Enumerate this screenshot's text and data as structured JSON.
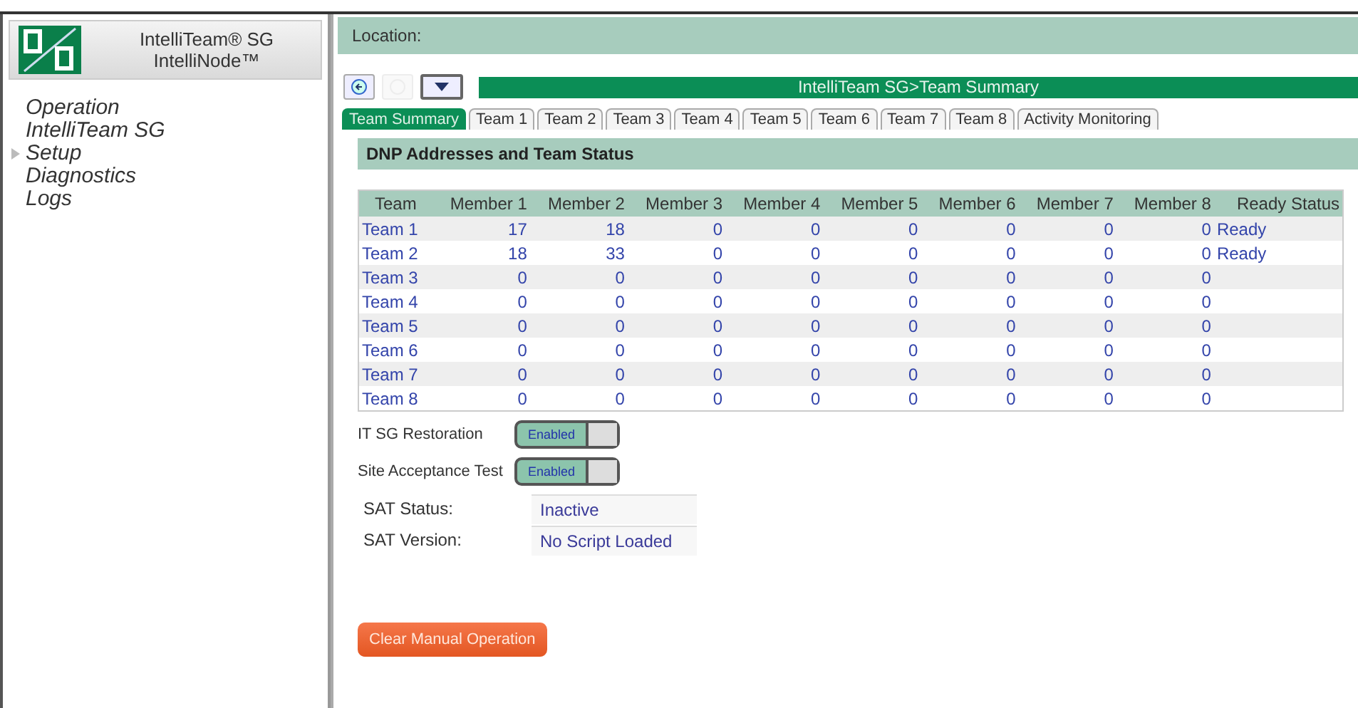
{
  "header": {
    "title": "IntelliTeam® SG",
    "subtitle": "IntelliNode™"
  },
  "menu": [
    {
      "label": "Operation",
      "expandable": false
    },
    {
      "label": "IntelliTeam SG",
      "expandable": false
    },
    {
      "label": "Setup",
      "expandable": true
    },
    {
      "label": "Diagnostics",
      "expandable": false
    },
    {
      "label": "Logs",
      "expandable": false
    }
  ],
  "location": {
    "label": "Location:"
  },
  "toolbar": {
    "buttons": [
      {
        "kind": "back",
        "disabled": false
      },
      {
        "kind": "forward",
        "disabled": true
      },
      {
        "kind": "dropdown",
        "disabled": false
      }
    ],
    "breadcrumb": "IntelliTeam SG>Team Summary"
  },
  "tabs": [
    {
      "label": "Team Summary",
      "selected": true
    },
    {
      "label": "Team 1",
      "selected": false
    },
    {
      "label": "Team 2",
      "selected": false
    },
    {
      "label": "Team 3",
      "selected": false
    },
    {
      "label": "Team 4",
      "selected": false
    },
    {
      "label": "Team 5",
      "selected": false
    },
    {
      "label": "Team 6",
      "selected": false
    },
    {
      "label": "Team 7",
      "selected": false
    },
    {
      "label": "Team 8",
      "selected": false
    },
    {
      "label": "Activity Monitoring",
      "selected": false
    }
  ],
  "section_title": "DNP Addresses and Team Status",
  "table": {
    "columns": [
      "Team",
      "Member 1",
      "Member 2",
      "Member 3",
      "Member 4",
      "Member 5",
      "Member 6",
      "Member 7",
      "Member 8",
      "Ready Status"
    ],
    "rows": [
      [
        "Team 1",
        "17",
        "18",
        "0",
        "0",
        "0",
        "0",
        "0",
        "0",
        "Ready"
      ],
      [
        "Team 2",
        "18",
        "33",
        "0",
        "0",
        "0",
        "0",
        "0",
        "0",
        "Ready"
      ],
      [
        "Team 3",
        "0",
        "0",
        "0",
        "0",
        "0",
        "0",
        "0",
        "0"
      ],
      [
        "Team 4",
        "0",
        "0",
        "0",
        "0",
        "0",
        "0",
        "0",
        "0"
      ],
      [
        "Team 5",
        "0",
        "0",
        "0",
        "0",
        "0",
        "0",
        "0",
        "0"
      ],
      [
        "Team 6",
        "0",
        "0",
        "0",
        "0",
        "0",
        "0",
        "0",
        "0"
      ],
      [
        "Team 7",
        "0",
        "0",
        "0",
        "0",
        "0",
        "0",
        "0",
        "0"
      ],
      [
        "Team 8",
        "0",
        "0",
        "0",
        "0",
        "0",
        "0",
        "0",
        "0"
      ]
    ]
  },
  "toggles": [
    {
      "label": "IT SG Restoration",
      "state": "Enabled",
      "on": true
    },
    {
      "label": "Site Acceptance Test",
      "state": "Enabled",
      "on": true
    }
  ],
  "status_fields": [
    {
      "label": "SAT Status:",
      "value": "Inactive"
    },
    {
      "label": "SAT Version:",
      "value": "No Script Loaded"
    }
  ],
  "action_button": "Clear Manual Operation"
}
